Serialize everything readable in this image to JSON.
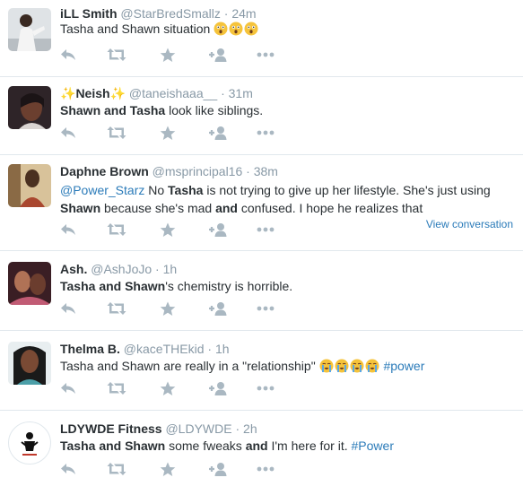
{
  "tweets": [
    {
      "name": "iLL Smith",
      "handle": "@StarBredSmallz",
      "time": "24m",
      "segments": [
        {
          "text": "Tasha and Shawn situation "
        }
      ],
      "emoji": "astonished",
      "emoji_count": 3
    },
    {
      "name_prefix": "✨",
      "name": "Neish",
      "name_suffix": "✨",
      "handle": "@taneishaaa__",
      "time": "31m",
      "segments": [
        {
          "text": "Shawn and Tasha",
          "bold": true
        },
        {
          "text": " look like siblings."
        }
      ]
    },
    {
      "name": "Daphne Brown",
      "handle": "@msprincipal16",
      "time": "38m",
      "segments": [
        {
          "text": "@Power_Starz",
          "link": true
        },
        {
          "text": " No "
        },
        {
          "text": "Tasha",
          "bold": true
        },
        {
          "text": " is not trying to give up her lifestyle. She's just using "
        },
        {
          "text": "Shawn",
          "bold": true
        },
        {
          "text": " because she's mad "
        },
        {
          "text": "and",
          "bold": true
        },
        {
          "text": " confused. I hope he realizes that"
        }
      ],
      "view_conversation": "View conversation"
    },
    {
      "name": "Ash.",
      "handle": "@AshJoJo",
      "time": "1h",
      "segments": [
        {
          "text": "Tasha and Shawn",
          "bold": true
        },
        {
          "text": "'s chemistry is horrible."
        }
      ]
    },
    {
      "name": "Thelma B.",
      "handle": "@kaceTHEkid",
      "time": "1h",
      "segments": [
        {
          "text": "Tasha and Shawn are really in a \"relationship\" "
        }
      ],
      "emoji": "sob",
      "emoji_count": 4,
      "trailing": [
        {
          "text": " "
        },
        {
          "text": "#power",
          "link": true
        }
      ]
    },
    {
      "name": "LDYWDE Fitness",
      "handle": "@LDYWDE",
      "time": "2h",
      "segments": [
        {
          "text": "Tasha and Shawn",
          "bold": true
        },
        {
          "text": " some fweaks "
        },
        {
          "text": "and",
          "bold": true
        },
        {
          "text": " I'm here for it. "
        },
        {
          "text": "#Power",
          "link": true
        }
      ]
    }
  ],
  "dot": "·",
  "actions": [
    "reply-icon",
    "retweet-icon",
    "favorite-icon",
    "follow-icon",
    "more-icon"
  ],
  "colors": {
    "link": "#2b7bb9",
    "meta": "#8899a6",
    "icon": "#aab8c2",
    "divider": "#e1e8ed"
  }
}
